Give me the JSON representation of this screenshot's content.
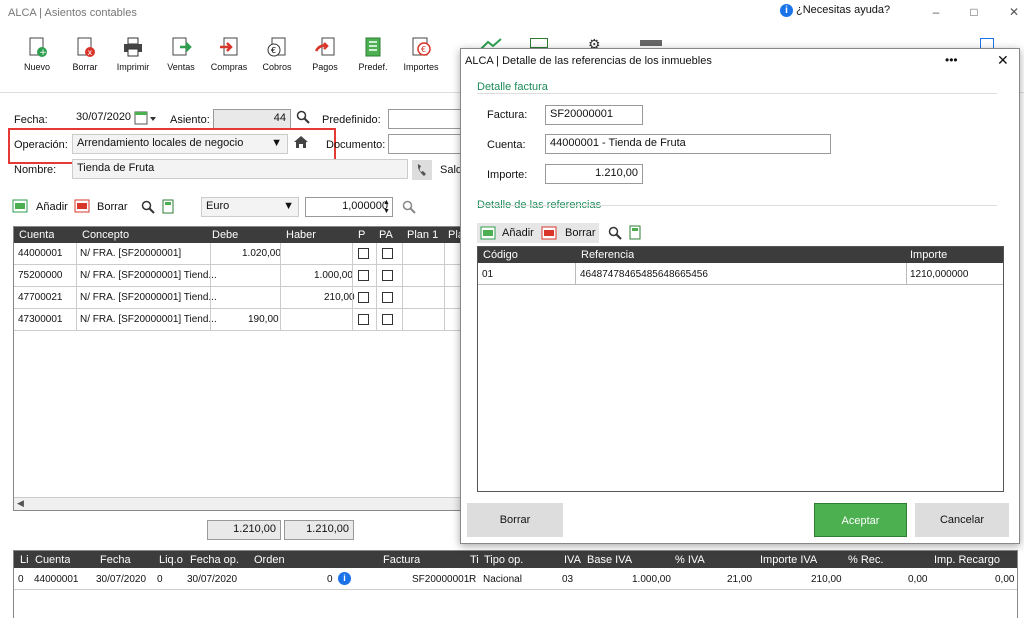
{
  "window": {
    "title": "ALCA | Asientos contables",
    "help": "¿Necesitas ayuda?"
  },
  "toolbar": [
    {
      "label": "Nuevo",
      "icon": "new-doc-icon"
    },
    {
      "label": "Borrar",
      "icon": "delete-doc-icon"
    },
    {
      "label": "Imprimir",
      "icon": "printer-icon"
    },
    {
      "label": "Ventas",
      "icon": "sales-icon"
    },
    {
      "label": "Compras",
      "icon": "purchases-icon"
    },
    {
      "label": "Cobros",
      "icon": "collections-icon"
    },
    {
      "label": "Pagos",
      "icon": "payments-icon"
    },
    {
      "label": "Predef.",
      "icon": "predefined-icon"
    },
    {
      "label": "Importes",
      "icon": "amounts-icon"
    }
  ],
  "form": {
    "fecha_label": "Fecha:",
    "fecha": "30/07/2020",
    "asiento_label": "Asiento:",
    "asiento": "44",
    "predefinido_label": "Predefinido:",
    "operacion_label": "Operación:",
    "operacion": "Arrendamiento locales de negocio",
    "documento_label": "Documento:",
    "nombre_label": "Nombre:",
    "nombre": "Tienda de Fruta",
    "saldo_label": "Sald"
  },
  "actions": {
    "anadir": "Añadir",
    "borrar": "Borrar",
    "currency": "Euro",
    "rate": "1,000000"
  },
  "entries": {
    "headers": [
      "Cuenta",
      "Concepto",
      "Debe",
      "Haber",
      "P",
      "PA",
      "Plan 1",
      "Pla"
    ],
    "rows": [
      {
        "cuenta": "44000001",
        "concepto": "N/ FRA. [SF20000001]",
        "debe": "1.020,00",
        "haber": ""
      },
      {
        "cuenta": "75200000",
        "concepto": "N/ FRA. [SF20000001] Tiend...",
        "debe": "",
        "haber": "1.000,00"
      },
      {
        "cuenta": "47700021",
        "concepto": "N/ FRA. [SF20000001] Tiend...",
        "debe": "",
        "haber": "210,00"
      },
      {
        "cuenta": "47300001",
        "concepto": "N/ FRA. [SF20000001] Tiend...",
        "debe": "190,00",
        "haber": ""
      }
    ],
    "total_debe": "1.210,00",
    "total_haber": "1.210,00"
  },
  "iva": {
    "headers": [
      "Li",
      "Cuenta",
      "Fecha",
      "Liq.o",
      "Fecha op.",
      "Orden",
      "Factura",
      "Ti",
      "Tipo op.",
      "IVA",
      "Base IVA",
      "% IVA",
      "Importe IVA",
      "% Rec.",
      "Imp. Recargo"
    ],
    "row": {
      "li": "0",
      "cuenta": "44000001",
      "fecha": "30/07/2020",
      "liq": "0",
      "fecha_op": "30/07/2020",
      "orden": "0",
      "factura": "SF20000001",
      "ti": "R",
      "tipo_op": "Nacional",
      "iva": "03",
      "base": "1.000,00",
      "pct_iva": "21,00",
      "importe_iva": "210,00",
      "pct_rec": "0,00",
      "imp_rec": "0,00"
    }
  },
  "dialog": {
    "title": "ALCA | Detalle de las referencias de los inmuebles",
    "section1": "Detalle factura",
    "factura_label": "Factura:",
    "factura": "SF20000001",
    "cuenta_label": "Cuenta:",
    "cuenta": "44000001 - Tienda de Fruta",
    "importe_label": "Importe:",
    "importe": "1.210,00",
    "section2": "Detalle de las referencias",
    "anadir": "Añadir",
    "borrar_small": "Borrar",
    "headers": [
      "Código",
      "Referencia",
      "Importe"
    ],
    "rows": [
      {
        "codigo": "01",
        "referencia": "46487478465485648665456",
        "importe": "1210,000000"
      }
    ],
    "borrar": "Borrar",
    "aceptar": "Aceptar",
    "cancelar": "Cancelar"
  },
  "colors": {
    "accent_green": "#4caf50",
    "header_dark": "#3c3c3c",
    "highlight_red": "#e53935",
    "info_blue": "#1a73e8"
  }
}
